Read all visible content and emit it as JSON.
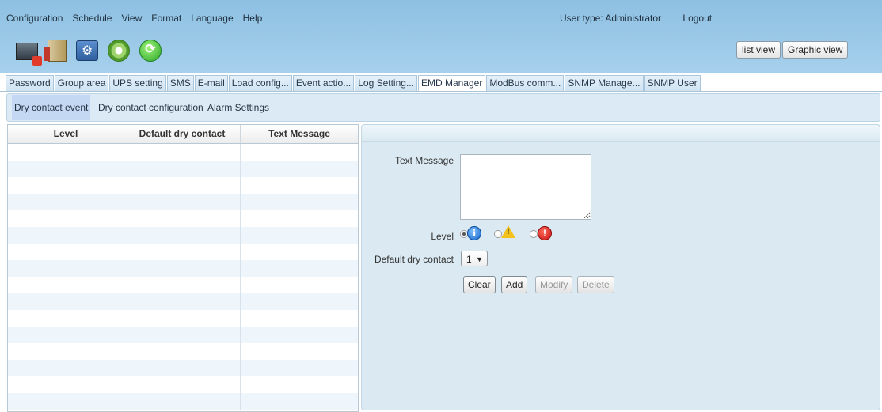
{
  "menu": [
    "Configuration",
    "Schedule",
    "View",
    "Format",
    "Language",
    "Help"
  ],
  "user": {
    "type_label": "User type:",
    "type_value": "Administrator",
    "logout": "Logout"
  },
  "toolbar_icons": [
    "monitor-icon",
    "building-icon",
    "tools-icon",
    "cd-icon",
    "sync-icon"
  ],
  "views": {
    "list": "list view",
    "graphic": "Graphic view"
  },
  "tabs": [
    {
      "label": "Password",
      "active": false
    },
    {
      "label": "Group area",
      "active": false
    },
    {
      "label": "UPS setting",
      "active": false
    },
    {
      "label": "SMS",
      "active": false
    },
    {
      "label": "E-mail",
      "active": false
    },
    {
      "label": "Load config...",
      "active": false
    },
    {
      "label": "Event actio...",
      "active": false
    },
    {
      "label": "Log Setting...",
      "active": false
    },
    {
      "label": "EMD Manager",
      "active": true
    },
    {
      "label": "ModBus comm...",
      "active": false
    },
    {
      "label": "SNMP Manage...",
      "active": false
    },
    {
      "label": "SNMP User",
      "active": false
    }
  ],
  "subtabs": [
    {
      "label": "Dry contact event",
      "active": true
    },
    {
      "label": "Dry contact configuration",
      "active": false
    },
    {
      "label": "Alarm Settings",
      "active": false
    }
  ],
  "table": {
    "columns": [
      "Level",
      "Default dry contact",
      "Text Message"
    ],
    "rows": []
  },
  "form": {
    "text_message_label": "Text Message",
    "text_message_value": "",
    "level_label": "Level",
    "level_options": [
      "info-icon",
      "warning-icon",
      "error-icon"
    ],
    "level_selected": "info-icon",
    "dry_contact_label": "Default dry contact",
    "dry_contact_value": "1",
    "buttons": {
      "clear": "Clear",
      "add": "Add",
      "modify": "Modify",
      "delete": "Delete"
    }
  },
  "colors": {
    "header_bg": "#9fcbe8",
    "panel_bg": "#dbeaf2",
    "active_subtab": "#c5d8f3"
  }
}
